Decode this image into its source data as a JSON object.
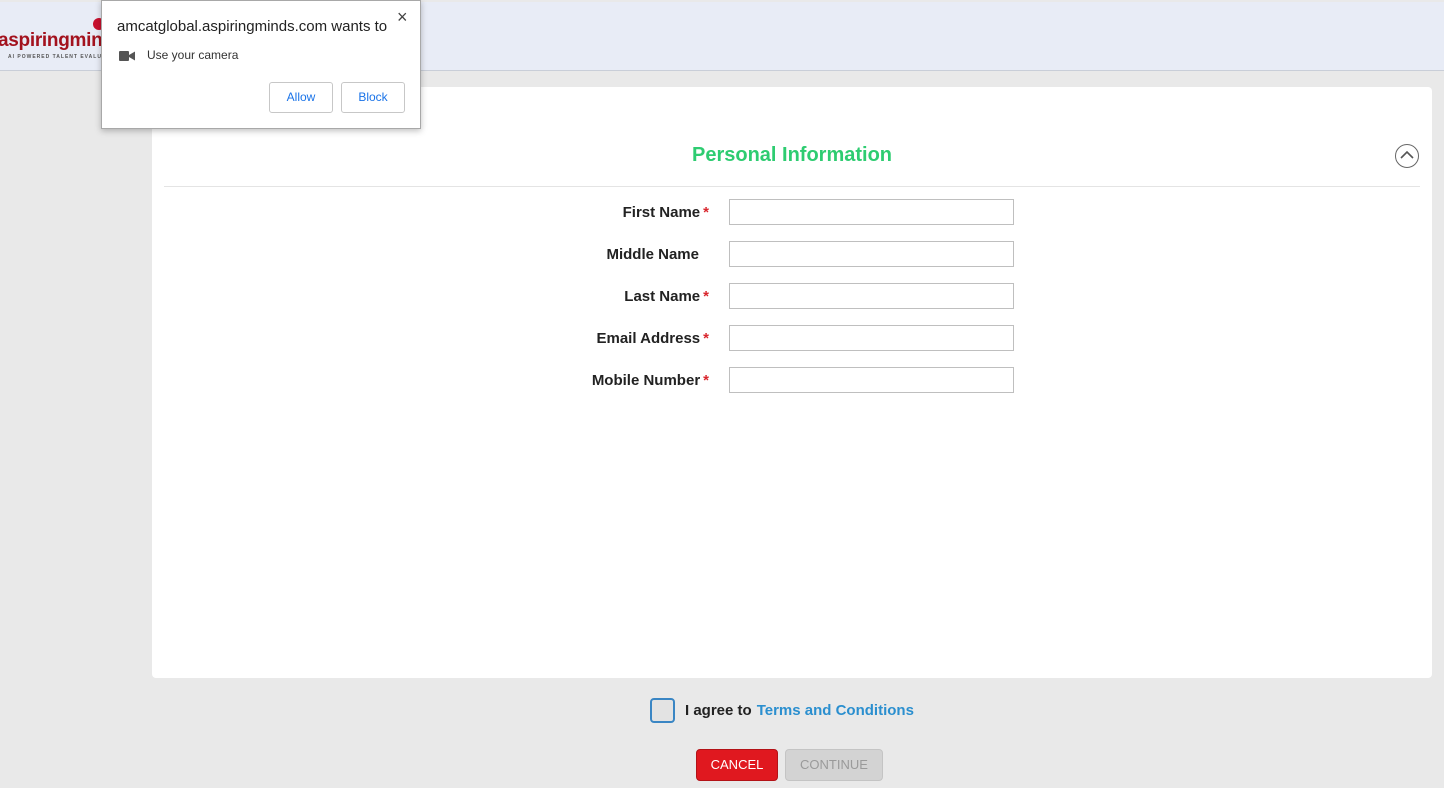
{
  "header": {
    "logo_text": "aspiringminds",
    "logo_tagline": "AI POWERED TALENT EVALUATION"
  },
  "permission_popup": {
    "title": "amcatglobal.aspiringminds.com wants to",
    "permission": "Use your camera",
    "permission_icon": "camera-icon",
    "close_symbol": "×",
    "allow_label": "Allow",
    "block_label": "Block"
  },
  "form": {
    "section_title": "Personal Information",
    "collapse_icon": "chevron-up-circle-icon",
    "fields": [
      {
        "label": "First Name",
        "required": true,
        "value": ""
      },
      {
        "label": "Middle Name",
        "required": false,
        "value": ""
      },
      {
        "label": "Last Name",
        "required": true,
        "value": ""
      },
      {
        "label": "Email Address",
        "required": true,
        "value": ""
      },
      {
        "label": "Mobile Number",
        "required": true,
        "value": ""
      }
    ],
    "required_marker": "*"
  },
  "agreement": {
    "checked": false,
    "prefix": "I agree to",
    "link_text": "Terms and Conditions"
  },
  "actions": {
    "cancel_label": "CANCEL",
    "continue_label": "CONTINUE",
    "continue_enabled": false
  },
  "colors": {
    "title_green": "#2ecc71",
    "required_red": "#d9262d",
    "link_blue": "#2b8fcf",
    "cancel_red": "#e0181f",
    "brand_red": "#a3121e"
  }
}
